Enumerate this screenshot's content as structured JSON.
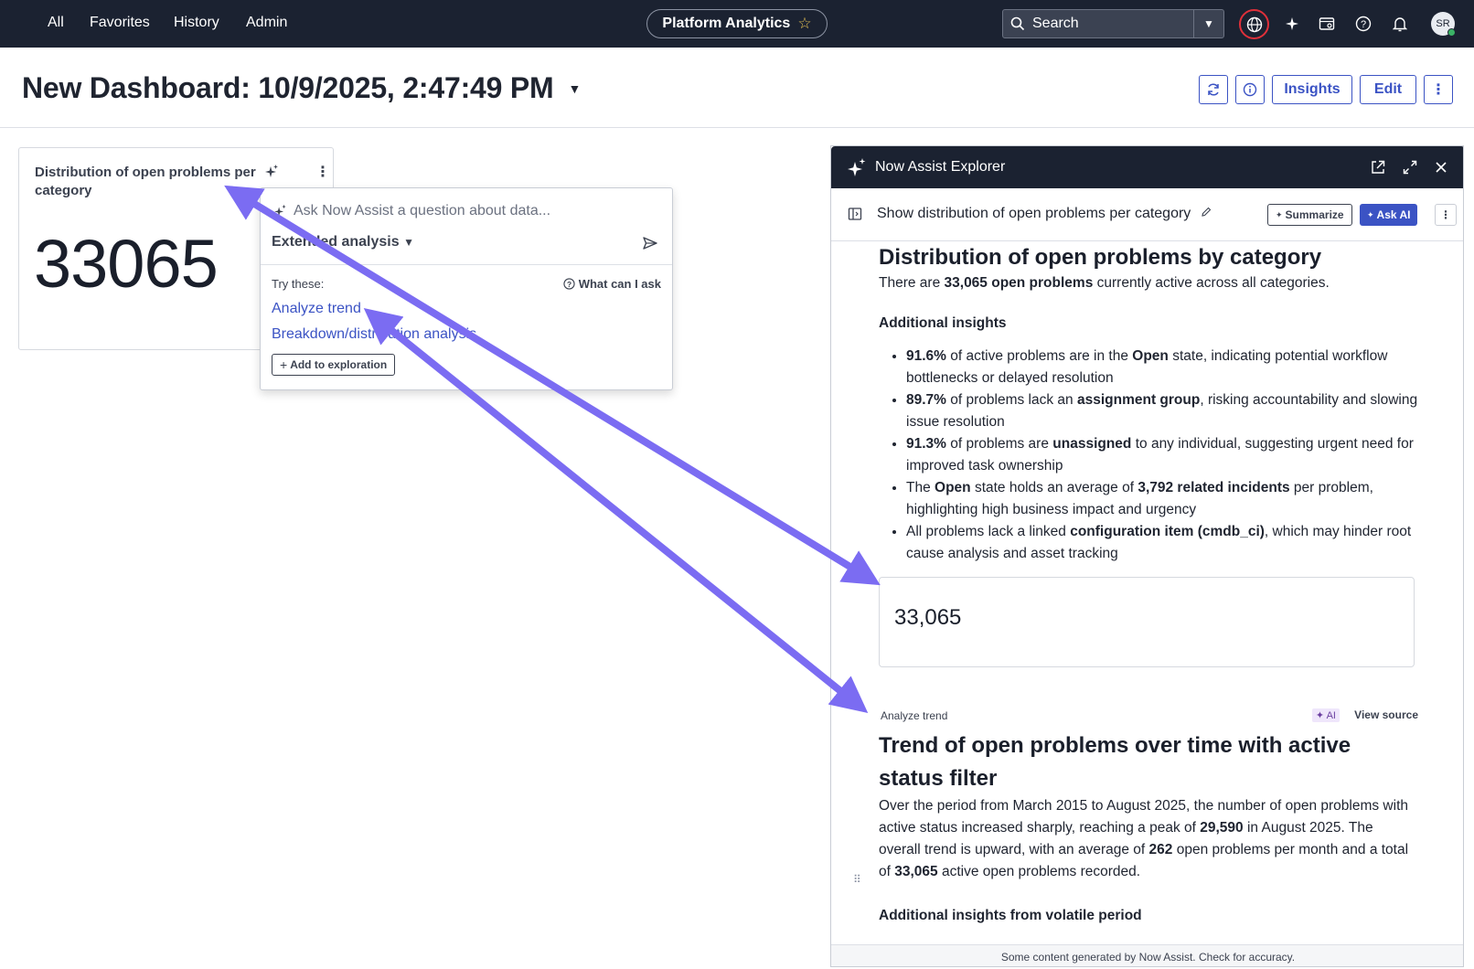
{
  "topnav": {
    "links": [
      "All",
      "Favorites",
      "History",
      "Admin"
    ],
    "app_title": "Platform Analytics",
    "search_placeholder": "Search",
    "avatar_initials": "SR"
  },
  "header": {
    "title": "New Dashboard: 10/9/2025, 2:47:49 PM",
    "insights_label": "Insights",
    "edit_label": "Edit"
  },
  "widget": {
    "title": "Distribution of open problems per category",
    "value": "33065"
  },
  "popover": {
    "input_placeholder": "Ask Now Assist a question about data...",
    "mode": "Extended analysis",
    "try_label": "Try these:",
    "what_label": "What can I ask",
    "suggestions": [
      "Analyze trend",
      "Breakdown/distribution analysis"
    ],
    "add_label": "Add to exploration"
  },
  "explorer": {
    "title": "Now Assist Explorer",
    "query": "Show distribution of open problems per category",
    "summarize_label": "Summarize",
    "ask_ai_label": "Ask AI",
    "heading": "Distribution of open problems by category",
    "intro_pre": "There are ",
    "intro_bold": "33,065 open problems",
    "intro_post": " currently active across all categories.",
    "insights_heading": "Additional insights",
    "insights": [
      {
        "b1": "91.6%",
        "t1": " of active problems are in the ",
        "b2": "Open",
        "t2": " state, indicating potential workflow bottlenecks or delayed resolution"
      },
      {
        "b1": "89.7%",
        "t1": " of problems lack an ",
        "b2": "assignment group",
        "t2": ", risking accountability and slowing issue resolution"
      },
      {
        "b1": "91.3%",
        "t1": " of problems are ",
        "b2": "unassigned",
        "t2": " to any individual, suggesting urgent need for improved task ownership"
      },
      {
        "p0": "The ",
        "b1": "Open",
        "t1": " state holds an average of ",
        "b2": "3,792 related incidents",
        "t2": " per problem, highlighting high business impact and urgency"
      },
      {
        "p0": "All problems lack a linked ",
        "b2": "configuration item (cmdb_ci)",
        "t2": ", which may hinder root cause analysis and asset tracking"
      }
    ],
    "card_value": "33,065",
    "section_label": "Analyze trend",
    "ai_badge": "AI",
    "view_source": "View source",
    "trend_heading": "Trend of open problems over time with active status filter",
    "trend_p1": "Over the period from March 2015 to August 2025, the number of open problems with active status increased sharply, reaching a peak of ",
    "trend_b1": "29,590",
    "trend_p2": " in August 2025. The overall trend is upward, with an average of ",
    "trend_b2": "262",
    "trend_p3": " open problems per month and a total of ",
    "trend_b3": "33,065",
    "trend_p4": " active open problems recorded.",
    "volatile_heading": "Additional insights from volatile period",
    "footer": "Some content generated by Now Assist. Check for accuracy."
  },
  "colors": {
    "nav_bg": "#1b2231",
    "accent": "#3b53c4",
    "arrow": "#7b6cf2"
  }
}
